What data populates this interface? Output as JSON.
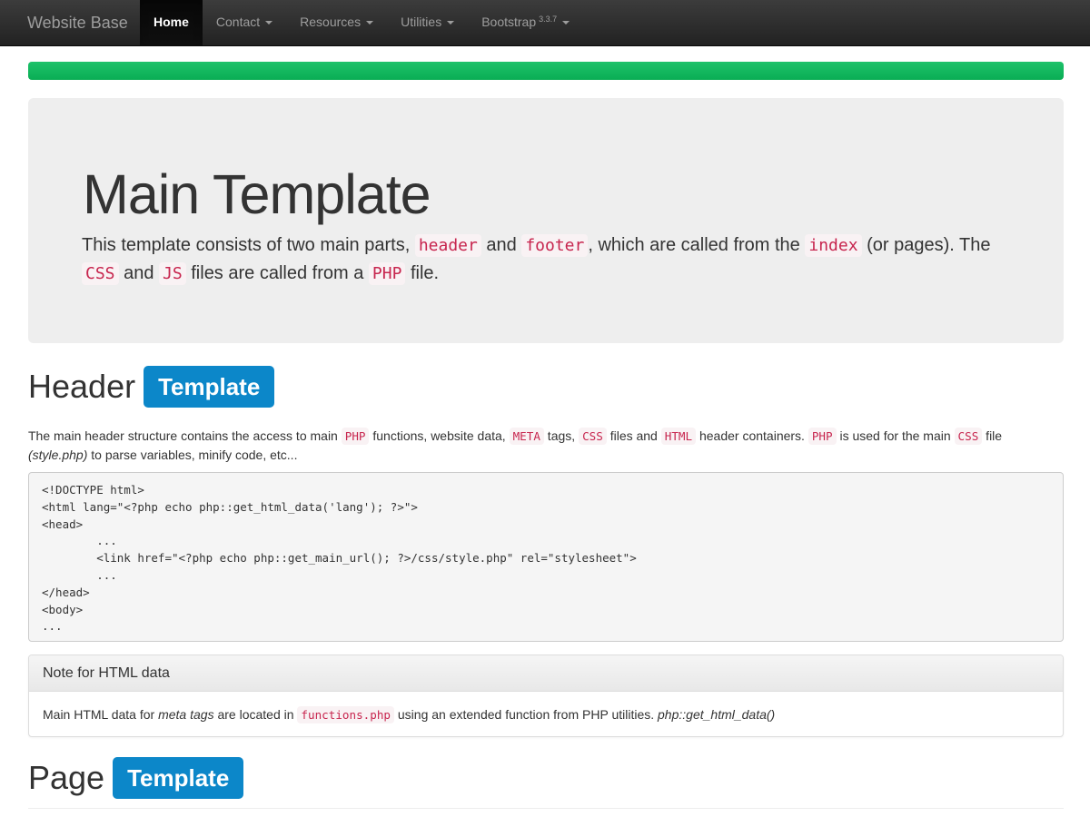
{
  "navbar": {
    "brand": "Website Base",
    "items": [
      {
        "label": "Home",
        "active": true,
        "dropdown": false
      },
      {
        "label": "Contact",
        "active": false,
        "dropdown": true
      },
      {
        "label": "Resources",
        "active": false,
        "dropdown": true
      },
      {
        "label": "Utilities",
        "active": false,
        "dropdown": true
      },
      {
        "label": "Bootstrap",
        "version": "3.3.7",
        "active": false,
        "dropdown": true
      }
    ]
  },
  "progress": {
    "percent": 100,
    "color": "#0aad54"
  },
  "jumbotron": {
    "title": "Main Template",
    "lead": {
      "t1": "This template consists of two main parts, ",
      "c1": "header",
      "t2": " and ",
      "c2": "footer",
      "t3": ", which are called from the ",
      "c3": "index",
      "t4": " (or pages). The ",
      "c4": "CSS",
      "t5": " and ",
      "c5": "JS",
      "t6": " files are called from a ",
      "c6": "PHP",
      "t7": " file."
    }
  },
  "header_section": {
    "title": "Header",
    "label": "Template",
    "paragraph": {
      "t1": "The main header structure contains the access to main ",
      "c1": "PHP",
      "t2": " functions, website data, ",
      "c2": "META",
      "t3": " tags, ",
      "c3": "CSS",
      "t4": " files and ",
      "c4": "HTML",
      "t5": " header containers. ",
      "c5": "PHP",
      "t6": " is used for the main ",
      "c6": "CSS",
      "t7": " file",
      "em": "(style.php)",
      "t8": " to parse variables, minify code, etc..."
    },
    "code": "<!DOCTYPE html>\n<html lang=\"<?php echo php::get_html_data('lang'); ?>\">\n<head>\n        ...\n        <link href=\"<?php echo php::get_main_url(); ?>/css/style.php\" rel=\"stylesheet\">\n        ...\n</head>\n<body>\n..."
  },
  "note_panel": {
    "heading": "Note for HTML data",
    "t1": "Main HTML data for ",
    "em1": "meta tags",
    "t2": " are located in ",
    "c1": "functions.php",
    "t3": " using an extended function from PHP utilities. ",
    "em2": "php::get_html_data()"
  },
  "page_section": {
    "title": "Page",
    "label": "Template"
  },
  "colors": {
    "navbar_bg": "#222222",
    "progress": "#0aad54",
    "label_bg": "#0c87c9",
    "code_text": "#c7254e",
    "code_bg": "#f9f2f4"
  }
}
